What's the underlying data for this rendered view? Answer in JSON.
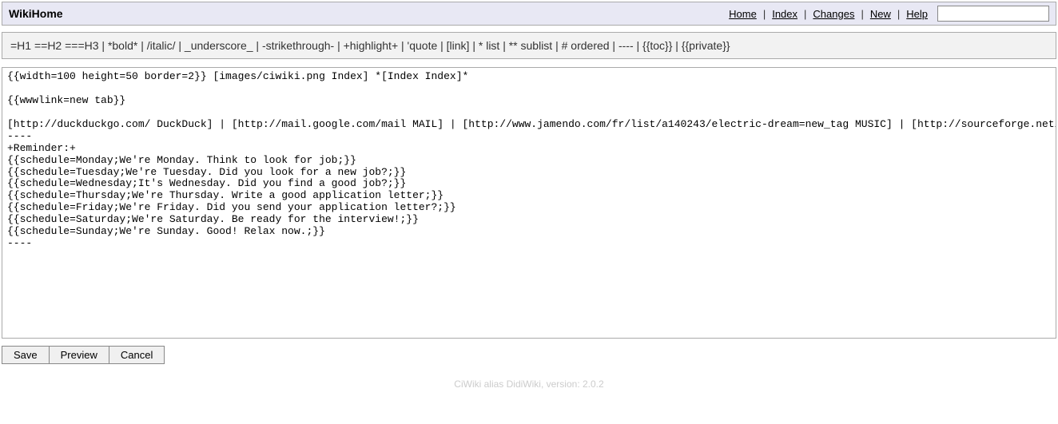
{
  "header": {
    "title": "WikiHome",
    "nav": {
      "home": "Home",
      "index": "Index",
      "changes": "Changes",
      "new": "New",
      "help": "Help"
    },
    "nav_sep": "|",
    "search_value": ""
  },
  "syntax_hint": "=H1 ==H2 ===H3 | *bold* | /italic/ | _underscore_ | -strikethrough- | +highlight+ | 'quote | [link] | * list | ** sublist | # ordered | ---- | {{toc}} | {{private}}",
  "editor_content": "{{width=100 height=50 border=2}} [images/ciwiki.png Index] *[Index Index]*\n\n{{wwwlink=new tab}}\n\n[http://duckduckgo.com/ DuckDuck] | [http://mail.google.com/mail MAIL] | [http://www.jamendo.com/fr/list/a140243/electric-dream=new_tag MUSIC] | [http://sourceforge.net/ SourceForge]\n----\n+Reminder:+\n{{schedule=Monday;We're Monday. Think to look for job;}}\n{{schedule=Tuesday;We're Tuesday. Did you look for a new job?;}}\n{{schedule=Wednesday;It's Wednesday. Did you find a good job?;}}\n{{schedule=Thursday;We're Thursday. Write a good application letter;}}\n{{schedule=Friday;We're Friday. Did you send your application letter?;}}\n{{schedule=Saturday;We're Saturday. Be ready for the interview!;}}\n{{schedule=Sunday;We're Sunday. Good! Relax now.;}}\n----",
  "buttons": {
    "save": "Save",
    "preview": "Preview",
    "cancel": "Cancel"
  },
  "footer": "CiWiki alias DidiWiki, version: 2.0.2"
}
